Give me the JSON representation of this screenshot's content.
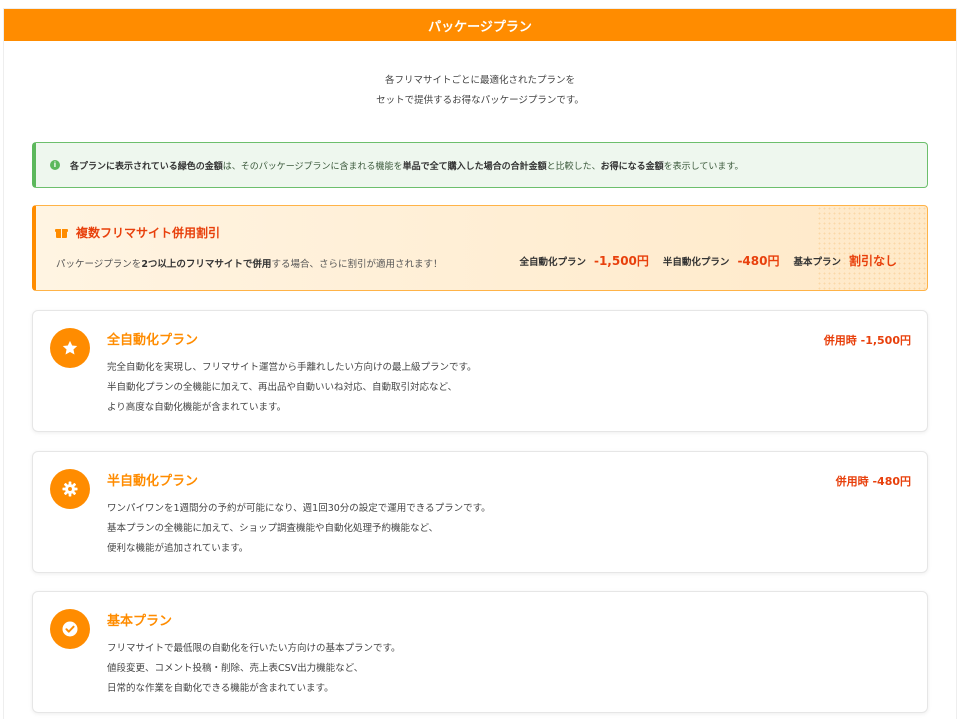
{
  "header": {
    "title": "パッケージプラン"
  },
  "intro": {
    "line1": "各フリマサイトごとに最適化されたプランを",
    "line2": "セットで提供するお得なパッケージプランです。"
  },
  "notice": {
    "icon": "info-icon",
    "parts": [
      {
        "text": "各プランに表示されている緑色の金額",
        "bold": true
      },
      {
        "text": "は、そのパッケージプランに含まれる機能を",
        "bold": false
      },
      {
        "text": "単品で全て購入した場合の合計金額",
        "bold": true
      },
      {
        "text": "と比較した、",
        "bold": false
      },
      {
        "text": "お得になる金額",
        "bold": true
      },
      {
        "text": "を表示しています。",
        "bold": false
      }
    ]
  },
  "discount": {
    "icon": "gift-icon",
    "title": "複数フリマサイト併用割引",
    "desc_a": "パッケージプランを",
    "desc_b": "2つ以上のフリマサイトで併用",
    "desc_c": "する場合、さらに割引が適用されます！",
    "prices": [
      {
        "label": "全自動化プラン",
        "value": "-1,500円"
      },
      {
        "label": "半自動化プラン",
        "value": "-480円"
      },
      {
        "label": "基本プラン",
        "value": "割引なし"
      }
    ]
  },
  "plans": [
    {
      "icon": "star-icon",
      "name": "全自動化プラン",
      "badge": "併用時 -1,500円",
      "lines": [
        "完全自動化を実現し、フリマサイト運営から手離れしたい方向けの最上級プランです。",
        "半自動化プランの全機能に加えて、再出品や自動いいね対応、自動取引対応など、",
        "より高度な自動化機能が含まれています。"
      ]
    },
    {
      "icon": "gear-icon",
      "name": "半自動化プラン",
      "badge": "併用時 -480円",
      "lines": [
        "ワンパイワンを1週間分の予約が可能になり、週1回30分の設定で運用できるプランです。",
        "基本プランの全機能に加えて、ショップ調査機能や自動化処理予約機能など、",
        "便利な機能が追加されています。"
      ]
    },
    {
      "icon": "check-circle-icon",
      "name": "基本プラン",
      "badge": "",
      "lines": [
        "フリマサイトで最低限の自動化を行いたい方向けの基本プランです。",
        "値段変更、コメント投稿・削除、売上表CSV出力機能など、",
        "日常的な作業を自動化できる機能が含まれています。"
      ]
    }
  ],
  "colors": {
    "brand": "#ff8c00",
    "accent_red": "#e8400c",
    "notice_green": "#5cb85c"
  }
}
